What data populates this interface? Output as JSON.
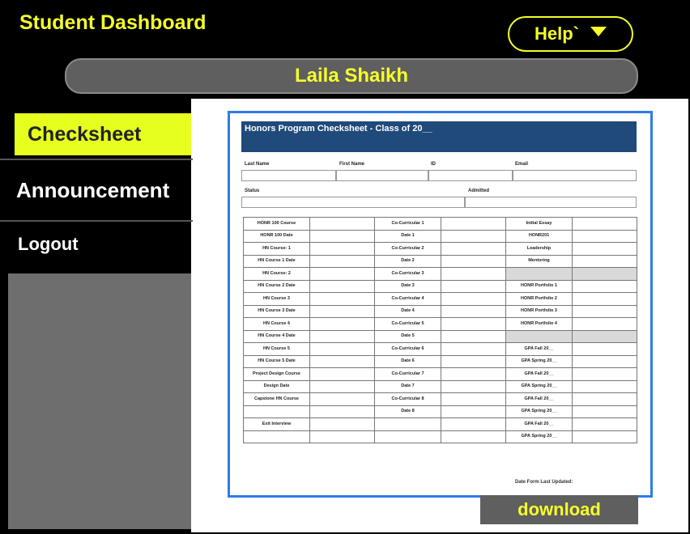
{
  "header": {
    "title": "Student Dashboard",
    "help_label": "Help`",
    "user_name": "Laila Shaikh"
  },
  "colors": {
    "accent": "#f5ff2a",
    "active_nav": "#e6ff1e",
    "header_bg": "#000000",
    "doc_border": "#2f7bea",
    "doc_header": "#1f4a7a"
  },
  "sidebar": {
    "items": [
      {
        "label": "Checksheet",
        "active": true
      },
      {
        "label": "Announcement",
        "active": false
      },
      {
        "label": "Logout",
        "active": false
      }
    ]
  },
  "document": {
    "title": "Honors Program Checksheet - Class of 20__",
    "fields": {
      "last_name": "Last Name",
      "first_name": "First Name",
      "id": "ID",
      "email": "Email",
      "status": "Status",
      "admitted": "Admitted"
    },
    "rows": [
      [
        "HONR 100 Course",
        "",
        "Co-Curricular 1",
        "",
        "Initial Essay",
        ""
      ],
      [
        "HONR 100 Date",
        "",
        "Date 1",
        "",
        "HONR201",
        ""
      ],
      [
        "HN Course: 1",
        "",
        "Co-Curricular 2",
        "",
        "Leadership",
        ""
      ],
      [
        "HN Course 1 Date",
        "",
        "Date 2",
        "",
        "Mentoring",
        ""
      ],
      [
        "HN Course: 2",
        "",
        "Co-Curricular 3",
        "",
        "",
        ""
      ],
      [
        "HN Course 2 Date",
        "",
        "Date 3",
        "",
        "HONR Portfolio 1",
        ""
      ],
      [
        "HN Course 3",
        "",
        "Co-Curricular 4",
        "",
        "HONR Portfolio 2",
        ""
      ],
      [
        "HN Course 3 Date",
        "",
        "Date 4",
        "",
        "HONR Portfolio 3",
        ""
      ],
      [
        "HN Course 4",
        "",
        "Co-Curricular 5",
        "",
        "HONR Portfolio 4",
        ""
      ],
      [
        "HN Course 4 Date",
        "",
        "Date 5",
        "",
        "",
        ""
      ],
      [
        "HN Course 5",
        "",
        "Co-Curricular 6",
        "",
        "GPA Fall 20__",
        ""
      ],
      [
        "HN Course 5 Date",
        "",
        "Date 6",
        "",
        "GPA Spring 20__",
        ""
      ],
      [
        "Project Design Course",
        "",
        "Co-Curricular 7",
        "",
        "GPA Fall 20__",
        ""
      ],
      [
        "Design Date",
        "",
        "Date 7",
        "",
        "GPA Spring 20__",
        ""
      ],
      [
        "Capstone HN Course",
        "",
        "Co-Curricular 8",
        "",
        "GPA Fall 20__",
        ""
      ],
      [
        "",
        "",
        "Date 8",
        "",
        "GPA Spring 20__",
        ""
      ],
      [
        "Exit Interview",
        "",
        "",
        "",
        "GPA Fall 20__",
        ""
      ],
      [
        "",
        "",
        "",
        "",
        "GPA Spring 20__",
        ""
      ]
    ],
    "footer": "Date Form Last Updated:"
  },
  "download_label": "download"
}
